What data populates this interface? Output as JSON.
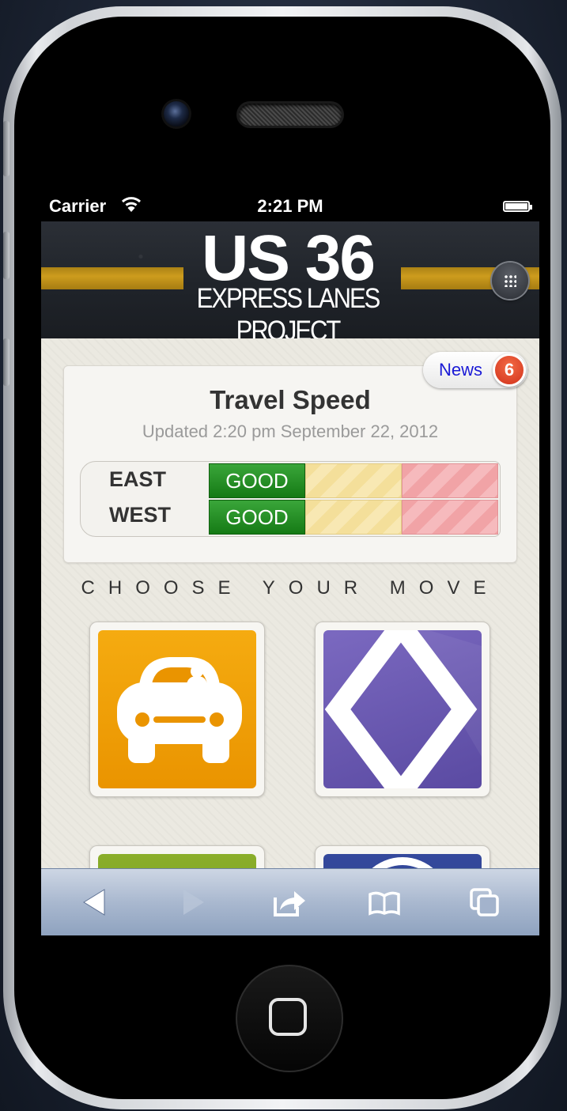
{
  "status_bar": {
    "carrier": "Carrier",
    "time": "2:21 PM",
    "wifi_icon": "wifi-icon",
    "battery_icon": "battery-icon"
  },
  "header": {
    "logo_title": "US 36",
    "logo_subtitle": "EXPRESS LANES PROJECT",
    "menu_icon": "grid-menu-icon"
  },
  "news": {
    "label": "News",
    "count": "6"
  },
  "travel_speed": {
    "title": "Travel Speed",
    "updated": "Updated 2:20 pm September 22, 2012",
    "rows": [
      {
        "direction": "EAST",
        "status": "GOOD"
      },
      {
        "direction": "WEST",
        "status": "GOOD"
      }
    ],
    "colors": {
      "good": "#1f8a1f",
      "moderate": "#f4df9a",
      "slow": "#f1a3a6"
    }
  },
  "section": {
    "title": "CHOOSE YOUR MOVE"
  },
  "tiles": [
    {
      "icon": "carpool-car-icon",
      "color": "#f0a000"
    },
    {
      "icon": "hov-diamond-icon",
      "color": "#6a58b0"
    },
    {
      "icon": "tile-3-icon",
      "color": "#7a9a22"
    },
    {
      "icon": "tile-4-icon",
      "color": "#2b3f8f"
    }
  ],
  "toolbar": {
    "back_icon": "back-arrow-icon",
    "forward_icon": "forward-arrow-icon",
    "share_icon": "share-icon",
    "bookmarks_icon": "bookmarks-book-icon",
    "tabs_icon": "tabs-pages-icon"
  }
}
